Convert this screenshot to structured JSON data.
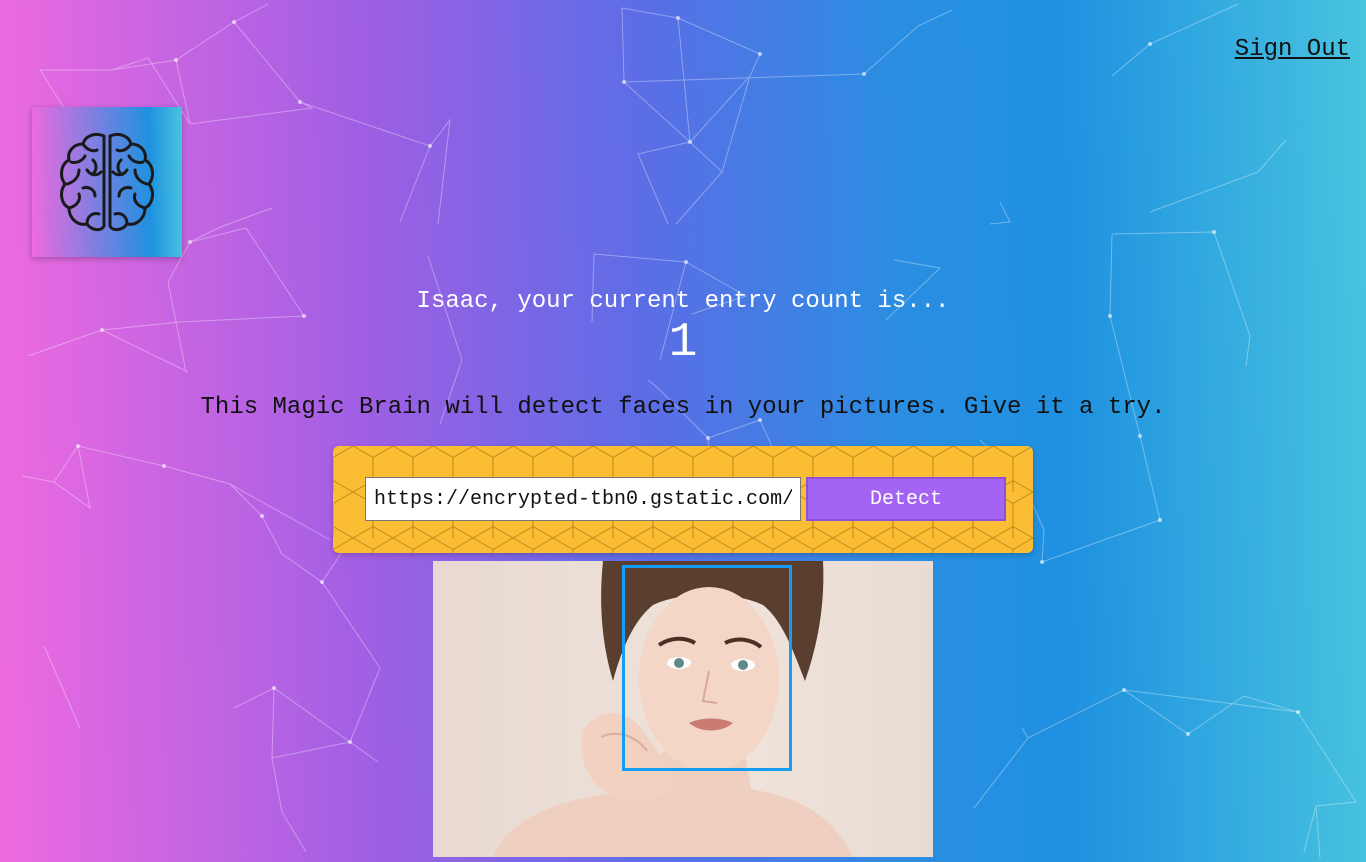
{
  "nav": {
    "sign_out": "Sign Out"
  },
  "logo": {
    "icon": "brain-icon"
  },
  "rank": {
    "message": "Isaac, your current entry count is...",
    "count": "1"
  },
  "intro": {
    "text": "This Magic Brain will detect faces in your pictures. Give it a try."
  },
  "form": {
    "input_value": "https://encrypted-tbn0.gstatic.com/i",
    "button_label": "Detect"
  },
  "result": {
    "image": "portrait-photo",
    "face_box": {
      "icon": "face-bounding-box"
    }
  },
  "colors": {
    "gradient_start": "#ee6ae0",
    "gradient_end": "#48c4df",
    "form_bg": "#fbbd33",
    "button_bg": "#a463f2",
    "face_box": "#149df2"
  }
}
